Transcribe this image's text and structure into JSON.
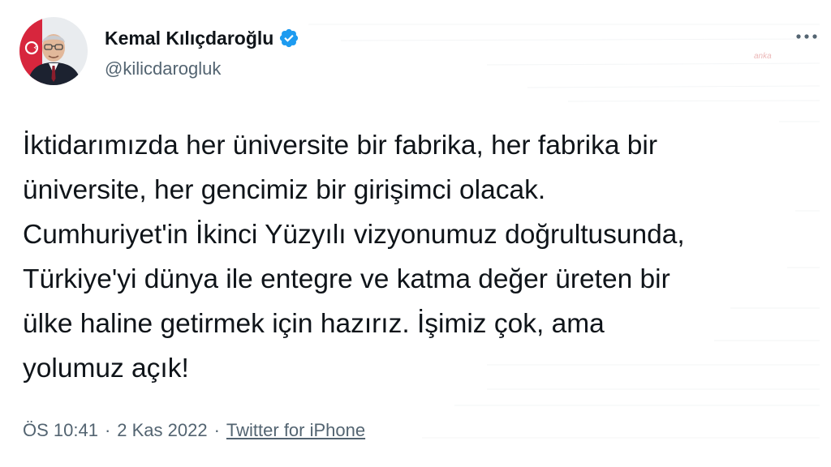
{
  "author": {
    "display_name": "Kemal Kılıçdaroğlu",
    "handle": "@kilicdarogluk",
    "verified": true,
    "verified_color": "#1d9bf0",
    "avatar_icon": "profile-photo"
  },
  "menu": {
    "icon": "more-dots-icon"
  },
  "watermark": {
    "text": "anka"
  },
  "tweet": {
    "lines": [
      "İktidarımızda her üniversite bir fabrika, her fabrika bir",
      "üniversite, her gencimiz bir girişimci olacak.",
      "Cumhuriyet'in İkinci Yüzyılı vizyonumuz doğrultusunda,",
      "Türkiye'yi dünya ile entegre ve katma değer üreten bir",
      "ülke haline getirmek için hazırız. İşimiz çok, ama",
      "yolumuz açık!"
    ]
  },
  "meta": {
    "time": "ÖS 10:41",
    "separator": "·",
    "date": "2 Kas 2022",
    "source": "Twitter for iPhone"
  }
}
